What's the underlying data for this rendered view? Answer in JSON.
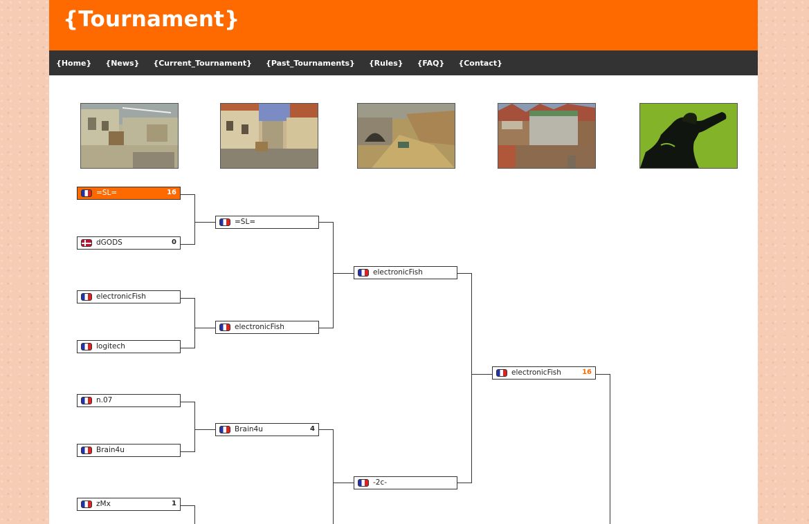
{
  "site": {
    "title": "{Tournament}"
  },
  "nav": [
    "{Home}",
    "{News}",
    "{Current_Tournament}",
    "{Past_Tournaments}",
    "{Rules}",
    "{FAQ}",
    "{Contact}"
  ],
  "maps": [
    "de_dust2",
    "de_inferno",
    "de_dust",
    "de_cbble",
    "sponsor"
  ],
  "colors": {
    "accent": "#ff6a00",
    "nav_bg": "#333333"
  },
  "bracket": {
    "round1": [
      {
        "team": "=SL=",
        "flag": "fr",
        "score": "16",
        "winner": true
      },
      {
        "team": "dGODS",
        "flag": "dk",
        "score": "0",
        "winner": false
      },
      {
        "team": "electronicFish",
        "flag": "fr",
        "score": "",
        "winner": false
      },
      {
        "team": "logitech",
        "flag": "fr",
        "score": "",
        "winner": false
      },
      {
        "team": "n.07",
        "flag": "fr",
        "score": "",
        "winner": false
      },
      {
        "team": "Brain4u",
        "flag": "fr",
        "score": "",
        "winner": false
      },
      {
        "team": "zMx",
        "flag": "fr",
        "score": "1",
        "winner": false
      }
    ],
    "round2": [
      {
        "team": "=SL=",
        "flag": "fr",
        "score": ""
      },
      {
        "team": "electronicFish",
        "flag": "fr",
        "score": ""
      },
      {
        "team": "Brain4u",
        "flag": "fr",
        "score": "4"
      }
    ],
    "round3": [
      {
        "team": "electronicFish",
        "flag": "fr",
        "score": ""
      },
      {
        "team": "-2c-",
        "flag": "fr",
        "score": ""
      }
    ],
    "round4": [
      {
        "team": "electronicFish",
        "flag": "fr",
        "score": "16"
      }
    ]
  }
}
